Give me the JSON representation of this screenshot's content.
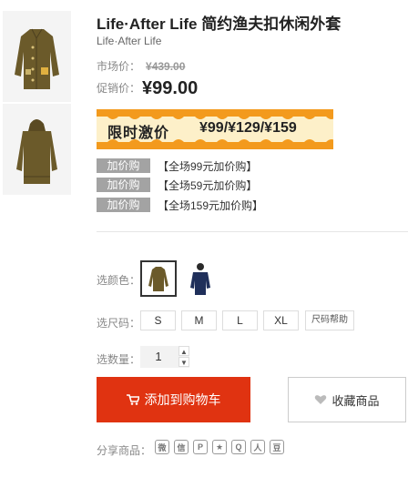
{
  "product": {
    "title": "Life·After Life 简约渔夫扣休闲外套",
    "brand": "Life·After Life"
  },
  "price": {
    "market_label": "市场价：",
    "market_value": "¥439.00",
    "promo_label": "促销价：",
    "promo_value": "¥99.00"
  },
  "banner": {
    "left_text": "限时激价",
    "right_text": "¥99/¥129/¥159",
    "colors": {
      "orange": "#f39a1d",
      "cream": "#fdf0c9"
    }
  },
  "add_buy": [
    {
      "tag": "加价购",
      "desc": "【全场99元加价购】"
    },
    {
      "tag": "加价购",
      "desc": "【全场59元加价购】"
    },
    {
      "tag": "加价购",
      "desc": "【全场159元加价购】"
    }
  ],
  "options": {
    "color_label": "选颜色：",
    "size_label": "选尺码：",
    "sizes": [
      "S",
      "M",
      "L",
      "XL"
    ],
    "size_help": "尺码帮助",
    "qty_label": "选数量：",
    "qty_value": "1",
    "qty_up": "▲",
    "qty_down": "▼"
  },
  "actions": {
    "cart_icon": "cart-icon",
    "cart_label": "添加到购物车",
    "fav_icon": "heart-icon",
    "fav_label": "收藏商品",
    "cart_color": "#e03311"
  },
  "share": {
    "label": "分享商品：",
    "icons": [
      {
        "name": "weibo-icon",
        "glyph": "微"
      },
      {
        "name": "wechat-icon",
        "glyph": "信"
      },
      {
        "name": "pinterest-icon",
        "glyph": "P"
      },
      {
        "name": "qzone-icon",
        "glyph": "★"
      },
      {
        "name": "qq-icon",
        "glyph": "Q"
      },
      {
        "name": "renren-icon",
        "glyph": "人"
      },
      {
        "name": "douban-icon",
        "glyph": "豆"
      }
    ]
  }
}
